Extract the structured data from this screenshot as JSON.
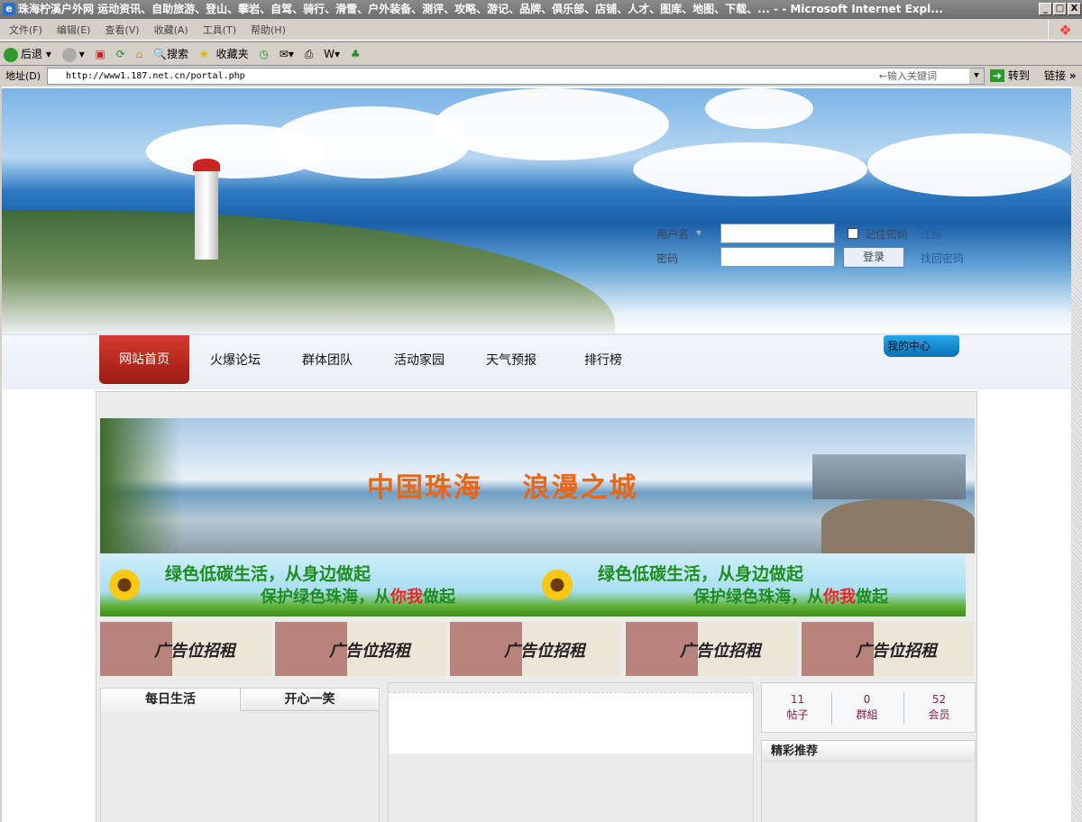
{
  "window": {
    "title": "珠海柠溪户外网 运动资讯、自助旅游、登山、攀岩、自驾、骑行、滑雪、户外装备、测评、攻略、游记、品牌、俱乐部、店铺、人才、图库、地图、下载、... - - Microsoft Internet Expl...",
    "minimize": "_",
    "maximize": "□",
    "close": "X"
  },
  "menu": [
    "文件(F)",
    "编辑(E)",
    "查看(V)",
    "收藏(A)",
    "工具(T)",
    "帮助(H)"
  ],
  "toolbar": {
    "back": "后退",
    "search": "搜索",
    "favorites": "收藏夹"
  },
  "address": {
    "label": "地址(D)",
    "url": "http://www1.187.net.cn/portal.php",
    "keyword_hint": "←输入关键词",
    "go": "转到",
    "links": "链接",
    "more": "»"
  },
  "login": {
    "username_label": "用户名",
    "password_label": "密码",
    "remember": "记住密码",
    "register": "注册",
    "login_button": "登录",
    "forgot": "找回密码"
  },
  "nav": {
    "items": [
      "网站首页",
      "火爆论坛",
      "群体团队",
      "活动家园",
      "天气预报",
      "排行榜"
    ],
    "my_center": "我的中心"
  },
  "banner": {
    "title": "中国珠海　 浪漫之城"
  },
  "green_banner": {
    "line1": "绿色低碳生活，从身边做起",
    "line2_a": "保护绿色珠海，从",
    "line2_b": "你我",
    "line2_c": "做起"
  },
  "ads": [
    "广告位招租",
    "广告位招租",
    "广告位招租",
    "广告位招租",
    "广告位招租"
  ],
  "left_tabs": [
    "每日生活",
    "开心一笑"
  ],
  "stats": [
    {
      "value": "11",
      "label": "帖子"
    },
    {
      "value": "0",
      "label": "群組"
    },
    {
      "value": "52",
      "label": "会员"
    }
  ],
  "recommend": {
    "title": "精彩推荐"
  }
}
